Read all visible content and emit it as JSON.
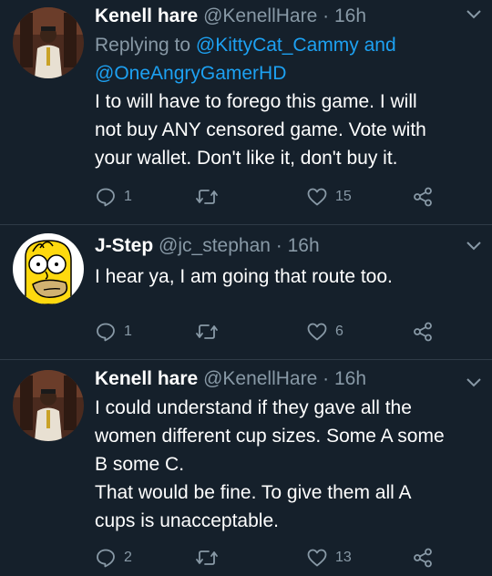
{
  "tweets": [
    {
      "name": "Kenell hare",
      "handle": "@KenellHare",
      "separator": "·",
      "time": "16h",
      "reply_prefix": "Replying to",
      "reply_user1": "@KittyCat_Cammy",
      "reply_and": "and",
      "reply_user2": "@OneAngryGamerHD",
      "text": [
        "I to will have to forego this game. I will",
        "not buy ANY censored game. Vote with",
        "your wallet. Don't like it, don't buy it."
      ],
      "replies": "1",
      "retweets": "",
      "likes": "15",
      "avatar_icon": "profile-photo"
    },
    {
      "name": "J-Step",
      "handle": "@jc_stephan",
      "separator": "·",
      "time": "16h",
      "text": [
        "I hear ya, I am going that route too."
      ],
      "replies": "1",
      "retweets": "",
      "likes": "6",
      "avatar_icon": "cartoon-face"
    },
    {
      "name": "Kenell hare",
      "handle": "@KenellHare",
      "separator": "·",
      "time": "16h",
      "text": [
        "I could understand if they gave all the",
        "women different cup sizes. Some A some",
        "B some C.",
        "That would be fine. To give them all A",
        "cups is unacceptable."
      ],
      "replies": "2",
      "retweets": "",
      "likes": "13",
      "avatar_icon": "profile-photo"
    }
  ],
  "theme": {
    "background": "#15202b",
    "text": "#ffffff",
    "muted": "#8899a6",
    "link": "#1da1f2"
  }
}
